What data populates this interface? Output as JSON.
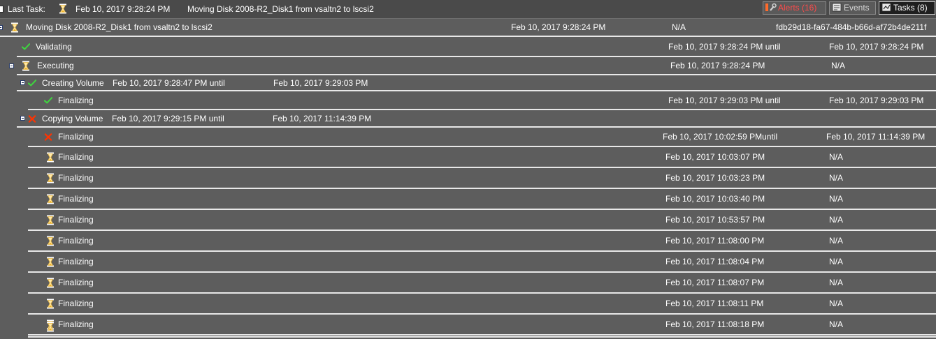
{
  "topbar": {
    "last_task_label": "Last Task:",
    "last_task_time": "Feb 10, 2017 9:28:24 PM",
    "last_task_title": "Moving Disk 2008-R2_Disk1 from vsaltn2 to lscsi2",
    "tabs": {
      "alerts": "Alerts (16)",
      "events": "Events",
      "tasks": "Tasks (8)"
    }
  },
  "tasks": {
    "root": {
      "title": "Moving Disk 2008-R2_Disk1 from vsaltn2 to lscsi2",
      "start": "Feb 10, 2017 9:28:24 PM",
      "end": "N/A",
      "id": "fdb29d18-fa67-484b-b66d-af72b4de211f",
      "status": "hourglass"
    },
    "validating": {
      "title": "Validating",
      "start": "Feb 10, 2017 9:28:24 PM until",
      "end": "Feb 10, 2017 9:28:24 PM",
      "status": "check"
    },
    "executing": {
      "title": "Executing",
      "start": "Feb 10, 2017 9:28:24 PM",
      "end": "N/A",
      "status": "hourglass"
    },
    "creating_volume": {
      "title": "Creating Volume",
      "start": "Feb 10, 2017 9:28:47 PM until",
      "end": "Feb 10, 2017 9:29:03 PM",
      "status": "check",
      "children": [
        {
          "title": "Finalizing",
          "start": "Feb 10, 2017 9:29:03 PM until",
          "end": "Feb 10, 2017 9:29:03 PM",
          "status": "check"
        }
      ]
    },
    "copying_volume": {
      "title": "Copying Volume",
      "start": "Feb 10, 2017 9:29:15 PM until",
      "end": "Feb 10, 2017 11:14:39 PM",
      "status": "error",
      "children": [
        {
          "title": "Finalizing",
          "start": "Feb 10, 2017 10:02:59 PMuntil",
          "end": "Feb 10, 2017 11:14:39 PM",
          "status": "error"
        },
        {
          "title": "Finalizing",
          "start": "Feb 10, 2017 10:03:07 PM",
          "end": "N/A",
          "status": "hourglass"
        },
        {
          "title": "Finalizing",
          "start": "Feb 10, 2017 10:03:23 PM",
          "end": "N/A",
          "status": "hourglass"
        },
        {
          "title": "Finalizing",
          "start": "Feb 10, 2017 10:03:40 PM",
          "end": "N/A",
          "status": "hourglass"
        },
        {
          "title": "Finalizing",
          "start": "Feb 10, 2017 10:53:57 PM",
          "end": "N/A",
          "status": "hourglass"
        },
        {
          "title": "Finalizing",
          "start": "Feb 10, 2017 11:08:00 PM",
          "end": "N/A",
          "status": "hourglass"
        },
        {
          "title": "Finalizing",
          "start": "Feb 10, 2017 11:08:04 PM",
          "end": "N/A",
          "status": "hourglass"
        },
        {
          "title": "Finalizing",
          "start": "Feb 10, 2017 11:08:07 PM",
          "end": "N/A",
          "status": "hourglass"
        },
        {
          "title": "Finalizing",
          "start": "Feb 10, 2017 11:08:11 PM",
          "end": "N/A",
          "status": "hourglass"
        },
        {
          "title": "Finalizing",
          "start": "Feb 10, 2017 11:08:18 PM",
          "end": "N/A",
          "status": "hourglass"
        }
      ]
    }
  },
  "colors": {
    "background": "#5d5d5d",
    "separator": "#e8e8e8",
    "check": "#3fd43f",
    "error": "#ff3300",
    "hourglass": "#ffe9a8",
    "alerts_text": "#ff4a4a"
  },
  "icons": {
    "collapse": "minus-box-icon",
    "check": "check-icon",
    "error": "x-icon",
    "hourglass": "hourglass-icon",
    "alerts": "wrench-alert-icon",
    "events": "events-flag-icon",
    "tasks": "tasks-icon"
  }
}
